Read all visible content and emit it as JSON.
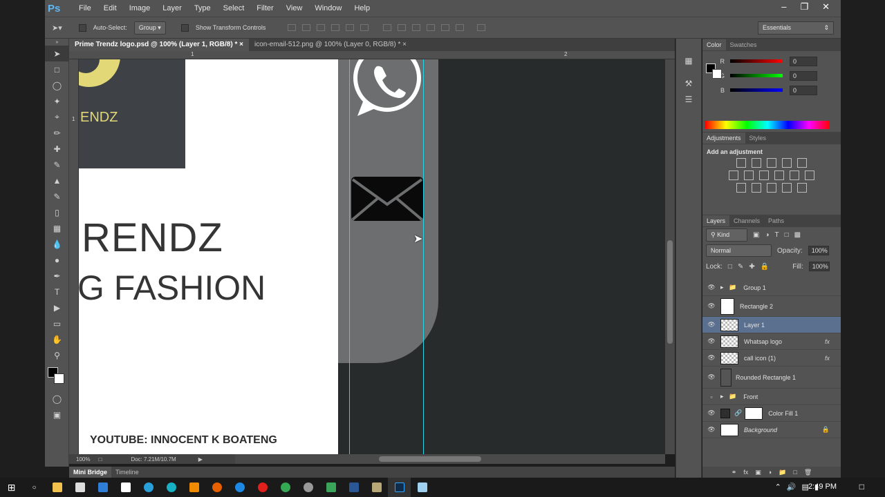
{
  "app": {
    "logo": "Ps",
    "menu": [
      "File",
      "Edit",
      "Image",
      "Layer",
      "Type",
      "Select",
      "Filter",
      "View",
      "Window",
      "Help"
    ]
  },
  "options": {
    "auto_select_label": "Auto-Select:",
    "auto_select_value": "Group",
    "show_transform": "Show Transform Controls",
    "workspace": "Essentials"
  },
  "tabs": [
    {
      "label": "Prime Trendz logo.psd @ 100% (Layer 1, RGB/8) *"
    },
    {
      "label": "icon-email-512.png @ 100% (Layer 0, RGB/8) *"
    }
  ],
  "ruler": {
    "h1": "1",
    "h2": "2",
    "v1": "1"
  },
  "canvas": {
    "logo_text": "ENDZ",
    "heading1": "RENDZ",
    "heading2": "G FASHION",
    "watermark": "YOUTUBE: INNOCENT K BOATENG"
  },
  "status": {
    "zoom": "100%",
    "doc": "Doc: 7.21M/10.7M"
  },
  "bottom_tabs": [
    "Mini Bridge",
    "Timeline"
  ],
  "color_panel": {
    "tabs": [
      "Color",
      "Swatches"
    ],
    "r_label": "R",
    "g_label": "G",
    "b_label": "B",
    "r": "0",
    "g": "0",
    "b": "0"
  },
  "adjustments": {
    "tabs": [
      "Adjustments",
      "Styles"
    ],
    "title": "Add an adjustment"
  },
  "layers_panel": {
    "tabs": [
      "Layers",
      "Channels",
      "Paths"
    ],
    "kind": "Kind",
    "blend": "Normal",
    "opacity_label": "Opacity:",
    "opacity": "100%",
    "lock_label": "Lock:",
    "fill_label": "Fill:",
    "fill": "100%",
    "layers": [
      {
        "name": "Group 1"
      },
      {
        "name": "Rectangle 2"
      },
      {
        "name": "Layer 1"
      },
      {
        "name": "Whatsap logo",
        "fx": "fx"
      },
      {
        "name": "call icon (1)",
        "fx": "fx"
      },
      {
        "name": "Rounded Rectangle 1"
      },
      {
        "name": "Front"
      },
      {
        "name": "Color Fill 1"
      },
      {
        "name": "Background"
      }
    ]
  },
  "taskbar": {
    "time": "2:49 PM"
  }
}
